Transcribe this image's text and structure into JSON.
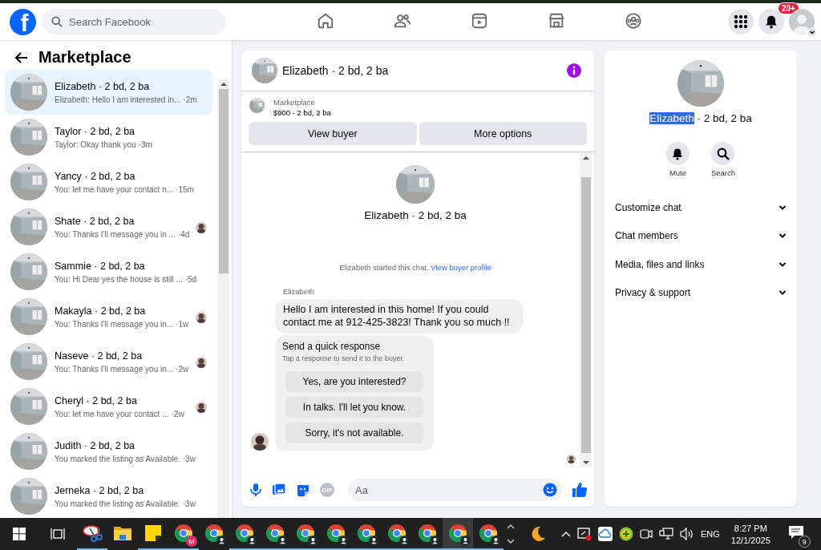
{
  "topbar": {
    "logo": "f",
    "search_placeholder": "Search Facebook",
    "nav": [
      {
        "kind": "home",
        "selected": false
      },
      {
        "kind": "friends",
        "selected": false
      },
      {
        "kind": "video",
        "selected": false
      },
      {
        "kind": "marketplace",
        "selected": false
      },
      {
        "kind": "groups",
        "selected": false
      }
    ],
    "notification_badge": "20+"
  },
  "sidebar": {
    "title": "Marketplace",
    "conversations": [
      {
        "name": "Elizabeth · 2 bd, 2 ba",
        "preview": "Elizabeth: Hello I am interested in...",
        "time": "·2m",
        "selected": true,
        "seen_avatar": false
      },
      {
        "name": "Taylor · 2 bd, 2 ba",
        "preview": "Taylor: Okay thank you",
        "time": "·3m",
        "selected": false,
        "seen_avatar": false
      },
      {
        "name": "Yancy · 2 bd, 2 ba",
        "preview": "You: let me have your contact n...",
        "time": "·15m",
        "selected": false,
        "seen_avatar": false
      },
      {
        "name": "Shate · 2 bd, 2 ba",
        "preview": "You: Thanks I'll message you in ...",
        "time": "·4d",
        "selected": false,
        "seen_avatar": true
      },
      {
        "name": "Sammie · 2 bd, 2 ba",
        "preview": "You: Hi Dear yes the house is still ...",
        "time": "·5d",
        "selected": false,
        "seen_avatar": false
      },
      {
        "name": "Makayla · 2 bd, 2 ba",
        "preview": "You: Thanks I'll message you in...",
        "time": "·1w",
        "selected": false,
        "seen_avatar": true
      },
      {
        "name": "Naseve · 2 bd, 2 ba",
        "preview": "You: Thanks I'll message you in...",
        "time": "·2w",
        "selected": false,
        "seen_avatar": true
      },
      {
        "name": "Cheryl · 2 bd, 2 ba",
        "preview": "You: let me have your contact ...",
        "time": "·2w",
        "selected": false,
        "seen_avatar": true
      },
      {
        "name": "Judith · 2 bd, 2 ba",
        "preview": "You marked the listing as Available.",
        "time": "·3w",
        "selected": false,
        "seen_avatar": false
      },
      {
        "name": "Jerneka · 2 bd, 2 ba",
        "preview": "You marked the listing as Available.",
        "time": "·3w",
        "selected": false,
        "seen_avatar": false
      }
    ]
  },
  "chat": {
    "title": "Elizabeth · 2 bd, 2 ba",
    "listing": {
      "label": "Marketplace",
      "price": "$900 - 2 bd, 2 ba"
    },
    "buttons": [
      "View buyer",
      "More options"
    ],
    "intro_title": "Elizabeth · 2 bd, 2 ba",
    "started_text": "Elizabeth started this chat.",
    "profile_link": "View buyer profile",
    "sender": "Elizabeth",
    "message": "Hello I am interested in this home! If you could contact me at 912-425-3823! Thank you so much !!",
    "quick": {
      "title": "Send a quick response",
      "hint": "Tap a response to send it to the buyer.",
      "options": [
        "Yes, are you interested?",
        "In talks. I'll let you know.",
        "Sorry, it's not available."
      ]
    },
    "composer": {
      "placeholder": "Aa",
      "gif": "GIF"
    }
  },
  "details": {
    "highlighted_part": "Elizabeth",
    "remaining_part": " · 2 bd, 2 ba",
    "actions": [
      {
        "kind": "mute",
        "label": "Mute"
      },
      {
        "kind": "search",
        "label": "Search"
      }
    ],
    "sections": [
      {
        "label": "Customize chat",
        "expanded": false
      },
      {
        "label": "Chat members",
        "expanded": false
      },
      {
        "label": "Media, files and links",
        "expanded": false
      },
      {
        "label": "Privacy & support",
        "expanded": false
      }
    ]
  },
  "taskbar": {
    "apps": [
      {
        "kind": "snip",
        "running": true,
        "selected": false
      },
      {
        "kind": "explorer",
        "running": false,
        "selected": false
      },
      {
        "kind": "sticky",
        "running": true,
        "selected": false
      },
      {
        "kind": "chrome",
        "badge": "M",
        "running": true,
        "selected": false
      },
      {
        "kind": "chrome",
        "running": false,
        "selected": false
      },
      {
        "kind": "chrome",
        "running": true,
        "selected": false
      },
      {
        "kind": "chrome",
        "running": true,
        "selected": false
      },
      {
        "kind": "chrome",
        "running": true,
        "selected": false
      },
      {
        "kind": "chrome",
        "running": true,
        "selected": false
      },
      {
        "kind": "chrome",
        "running": true,
        "selected": false
      },
      {
        "kind": "chrome",
        "running": true,
        "selected": false
      },
      {
        "kind": "chrome",
        "running": true,
        "selected": false
      },
      {
        "kind": "chrome",
        "running": true,
        "selected": true
      },
      {
        "kind": "chrome",
        "running": true,
        "selected": false
      }
    ],
    "language": "ENG",
    "time": "8:27 PM",
    "date": "12/1/2025",
    "notifications": "9"
  }
}
